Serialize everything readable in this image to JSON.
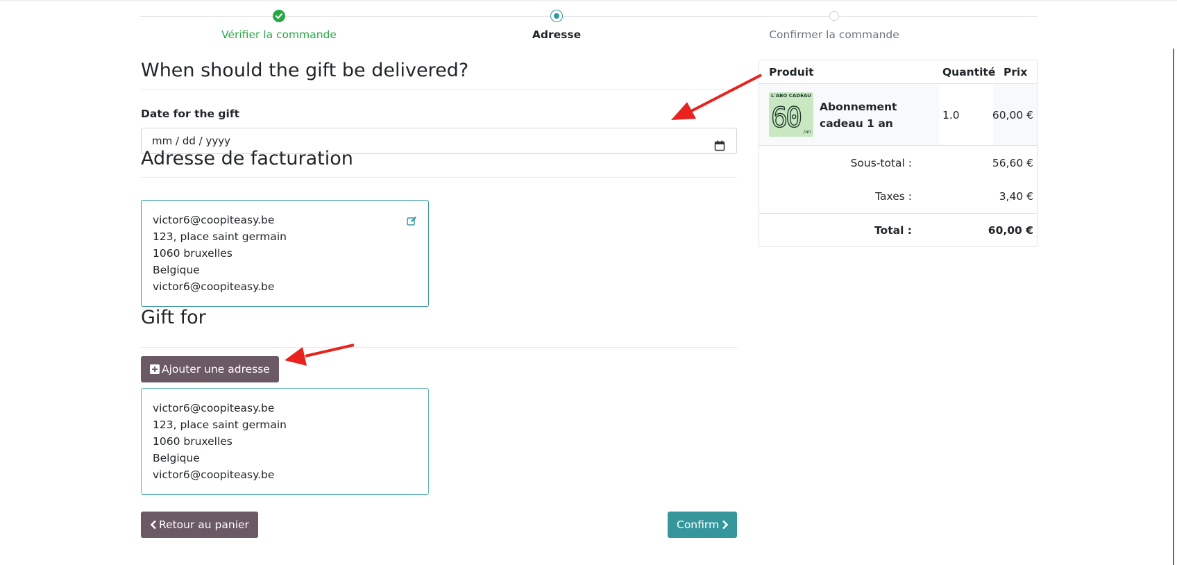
{
  "wizard": {
    "steps": [
      {
        "label": "Vérifier la commande",
        "state": "done"
      },
      {
        "label": "Adresse",
        "state": "current"
      },
      {
        "label": "Confirmer la commande",
        "state": "todo"
      }
    ]
  },
  "delivery": {
    "title": "When should the gift be delivered?",
    "date_label": "Date for the gift",
    "date_placeholder": "mm / dd / yyyy"
  },
  "billing": {
    "title": "Adresse de facturation",
    "lines": [
      "victor6@coopiteasy.be",
      "123, place saint germain",
      "1060 bruxelles",
      "Belgique",
      "victor6@coopiteasy.be"
    ]
  },
  "gift": {
    "title": "Gift for",
    "add_button": "Ajouter une adresse",
    "lines": [
      "victor6@coopiteasy.be",
      "123, place saint germain",
      "1060 bruxelles",
      "Belgique",
      "victor6@coopiteasy.be"
    ]
  },
  "actions": {
    "back_label": "Retour au panier",
    "confirm_label": "Confirm"
  },
  "summary": {
    "headers": {
      "product": "Produit",
      "quantity": "Quantité",
      "price": "Prix"
    },
    "item": {
      "name": "Abonnement cadeau 1 an",
      "quantity": "1.0",
      "price": "60,00 €",
      "thumbnail_text": {
        "top": "L'ABO CADEAU",
        "big": "60",
        "suffix": "/an"
      }
    },
    "subtotal_label": "Sous-total :",
    "subtotal_value": "56,60 €",
    "taxes_label": "Taxes :",
    "taxes_value": "3,40 €",
    "total_label": "Total :",
    "total_value": "60,00 €"
  },
  "colors": {
    "success": "#28a745",
    "primary": "#35979c",
    "secondary": "#6b5a66",
    "annotation_arrow": "#e8231f"
  }
}
